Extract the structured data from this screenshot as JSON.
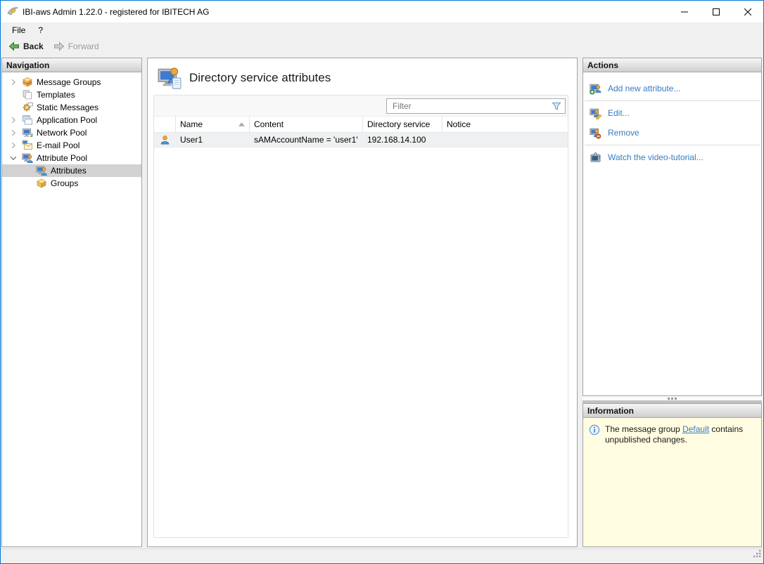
{
  "window": {
    "title": "IBI-aws Admin 1.22.0 - registered for IBITECH AG"
  },
  "menu_bar": {
    "items": [
      {
        "label": "File"
      },
      {
        "label": "?"
      }
    ]
  },
  "toolbar": {
    "back_label": "Back",
    "forward_label": "Forward"
  },
  "navigation": {
    "header": "Navigation",
    "items": [
      {
        "label": "Message Groups",
        "icon": "message-groups-icon",
        "state": "collapsed"
      },
      {
        "label": "Templates",
        "icon": "templates-icon",
        "state": "leaf"
      },
      {
        "label": "Static Messages",
        "icon": "static-messages-icon",
        "state": "leaf"
      },
      {
        "label": "Application Pool",
        "icon": "application-pool-icon",
        "state": "collapsed"
      },
      {
        "label": "Network Pool",
        "icon": "network-pool-icon",
        "state": "collapsed"
      },
      {
        "label": "E-mail Pool",
        "icon": "email-pool-icon",
        "state": "collapsed"
      },
      {
        "label": "Attribute Pool",
        "icon": "attribute-pool-icon",
        "state": "expanded"
      },
      {
        "label": "Attributes",
        "icon": "attributes-icon",
        "state": "child-selected"
      },
      {
        "label": "Groups",
        "icon": "groups-icon",
        "state": "child"
      }
    ]
  },
  "main": {
    "title": "Directory service attributes",
    "filter_placeholder": "Filter",
    "table": {
      "columns": {
        "name": "Name",
        "content": "Content",
        "directory_service": "Directory service",
        "notice": "Notice"
      },
      "sort": "Name ascending",
      "rows": [
        {
          "name": "User1",
          "content": "sAMAccountName = 'user1'",
          "directory_service": "192.168.14.100",
          "notice": ""
        }
      ]
    }
  },
  "actions": {
    "header": "Actions",
    "add_label": "Add new attribute...",
    "edit_label": "Edit...",
    "remove_label": "Remove",
    "video_label": "Watch the video-tutorial..."
  },
  "information": {
    "header": "Information",
    "text_before": "The message group ",
    "link_text": "Default",
    "text_after": " contains unpublished changes."
  },
  "colors": {
    "window_border": "#0078d7",
    "link_blue": "#3a7bbf",
    "info_background": "#fffce1",
    "selection_gray": "#d2d2d2",
    "row_highlight": "#eef0f2"
  }
}
